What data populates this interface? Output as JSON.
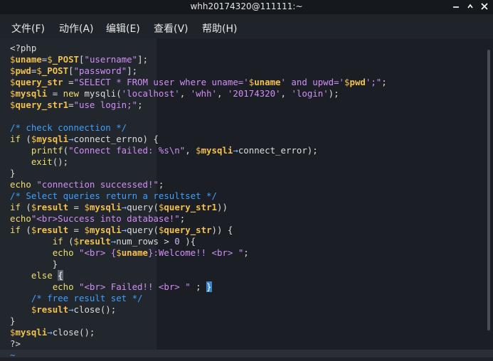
{
  "window": {
    "title": "whh20174320@111111:~",
    "controls": [
      "minimize-icon",
      "maximize-icon",
      "close-icon"
    ]
  },
  "menu": [
    {
      "label": "文件(F)"
    },
    {
      "label": "动作(A)"
    },
    {
      "label": "编辑(E)"
    },
    {
      "label": "查看(V)"
    },
    {
      "label": "帮助(H)"
    }
  ],
  "code_lines": [
    "<?php",
    "$uname=$_POST[\"username\"];",
    "$pwd=$_POST[\"password\"];",
    "$query_str =\"SELECT * FROM user where uname='$uname' and upwd='$pwd';\";",
    "$mysqli = new mysqli('localhost', 'whh', '20174320', 'login');",
    "$query_str1=\"use login;\";",
    "",
    "/* check connection */",
    "if ($mysqli→connect_errno) {",
    "    printf(\"Connect failed: %s\\n\", $mysqli→connect_error);",
    "    exit();",
    "}",
    "echo \"connection successed!\";",
    "/* Select queries return a resultset */",
    "if ($result = $mysqli→query($query_str1))",
    "echo\"<br>Success into database!\";",
    "if ($result = $mysqli→query($query_str)) {",
    "        if ($result→num_rows > 0 ){",
    "        echo \"<br> {$uname}:Welcome!! <br> \";",
    "        }",
    "    else {",
    "        echo \"<br> Failed!! <br> \" ; }",
    "    /* free result set */",
    "    $result→close();",
    "}",
    "$mysqli→close();",
    "?>",
    "~"
  ],
  "colors": {
    "background": "#1e2228",
    "titlebar": "#15181c",
    "menubar": "#1f232a",
    "variable": "#f2c14e",
    "string": "#d28ef7",
    "comment": "#3ea0ff",
    "arrow": "#77b8ff",
    "text": "#dcdcdc"
  }
}
